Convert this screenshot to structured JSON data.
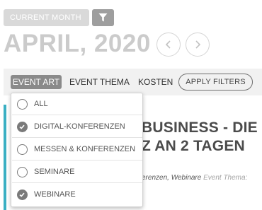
{
  "header": {
    "current_month_label": "CURRENT MONTH",
    "month_title": "APRIL, 2020"
  },
  "filter_bar": {
    "tabs": [
      {
        "label": "EVENT ART",
        "active": true
      },
      {
        "label": "EVENT THEMA",
        "active": false
      },
      {
        "label": "KOSTEN",
        "active": false
      }
    ],
    "apply_label": "APPLY FILTERS"
  },
  "dropdown": {
    "options": [
      {
        "label": "ALL",
        "checked": false
      },
      {
        "label": "DIGITAL-KONFERENZEN",
        "checked": true
      },
      {
        "label": "MESSEN & KONFERENZEN",
        "checked": false
      },
      {
        "label": "SEMINARE",
        "checked": false
      },
      {
        "label": "WEBINARE",
        "checked": true
      }
    ]
  },
  "event": {
    "title_line1": "BUSINESS - DIE V",
    "title_line2": "Z AN 2 TAGEN",
    "meta_values": "erenzen,  Webinare",
    "meta_label": "Event Thema:"
  },
  "colors": {
    "accent": "#3aafc3",
    "muted_text": "#cbcbcb",
    "active_tab": "#8a8a8a"
  },
  "icons": {
    "filter": "funnel-icon",
    "prev": "chevron-left-icon",
    "next": "chevron-right-icon",
    "check": "check-icon"
  }
}
